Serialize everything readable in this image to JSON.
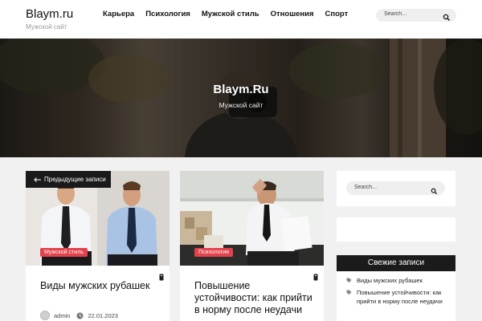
{
  "header": {
    "site_title": "Blaym.ru",
    "tagline": "Мужской сайт",
    "nav": [
      "Карьера",
      "Психология",
      "Мужской стиль",
      "Отношения",
      "Спорт"
    ],
    "search_placeholder": "Search..."
  },
  "hero": {
    "title": "Blaym.Ru",
    "subtitle": "Мужской сайт"
  },
  "prev_posts_label": "Предыдущие записи",
  "posts": [
    {
      "category": "Мужской стиль",
      "title": "Виды мужских рубашек",
      "author": "admin",
      "date": "22.01.2023"
    },
    {
      "category": "Психология",
      "title": "Повышение устойчивости: как прийти в норму после неудачи"
    }
  ],
  "sidebar": {
    "search_placeholder": "Search...",
    "recent_title": "Свежие записи",
    "recent": [
      "Виды мужских рубашек",
      "Повышение устойчивости: как прийти в норму после неудачи"
    ]
  },
  "colors": {
    "badge": "#e3414b",
    "dark": "#1b1b1b",
    "background": "#f1f1f1"
  },
  "icons": [
    "search-icon",
    "arrow-left-icon",
    "pin-icon",
    "user-avatar-icon",
    "clock-icon",
    "tag-icon"
  ]
}
